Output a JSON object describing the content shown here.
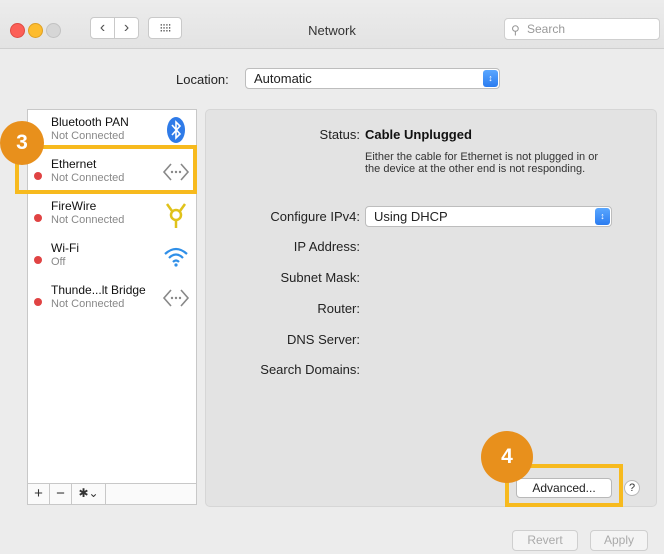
{
  "window": {
    "title": "Network"
  },
  "toolbar": {
    "back_glyph": "‹",
    "forward_glyph": "›",
    "grid_glyph": "⁝⁝⁝⁝",
    "search_placeholder": "Search"
  },
  "location": {
    "label": "Location:",
    "value": "Automatic"
  },
  "services": [
    {
      "name": "Bluetooth PAN",
      "status": "Not Connected",
      "status_color": "none",
      "icon": "bluetooth-icon"
    },
    {
      "name": "Ethernet",
      "status": "Not Connected",
      "status_color": "#e04343",
      "icon": "ethernet-icon"
    },
    {
      "name": "FireWire",
      "status": "Not Connected",
      "status_color": "#e04343",
      "icon": "firewire-icon"
    },
    {
      "name": "Wi-Fi",
      "status": "Off",
      "status_color": "#e04343",
      "icon": "wifi-icon"
    },
    {
      "name": "Thunde...lt Bridge",
      "status": "Not Connected",
      "status_color": "#e04343",
      "icon": "thunderbolt-bridge-icon"
    }
  ],
  "sidebar_bar": {
    "add": "+",
    "remove": "−",
    "gear": "✱⌄"
  },
  "detail": {
    "status_label": "Status:",
    "status_value": "Cable Unplugged",
    "status_description": "Either the cable for Ethernet is not plugged in or the device at the other end is not responding.",
    "configure_label": "Configure IPv4:",
    "configure_value": "Using DHCP",
    "ip_label": "IP Address:",
    "subnet_label": "Subnet Mask:",
    "router_label": "Router:",
    "dns_label": "DNS Server:",
    "search_domains_label": "Search Domains:"
  },
  "buttons": {
    "advanced": "Advanced...",
    "help": "?",
    "revert": "Revert",
    "apply": "Apply"
  },
  "annotations": {
    "step3": "3",
    "step4": "4"
  },
  "colors": {
    "highlight": "#f7ba1e",
    "badge": "#e8901c",
    "accent": "#2b7cf0"
  }
}
